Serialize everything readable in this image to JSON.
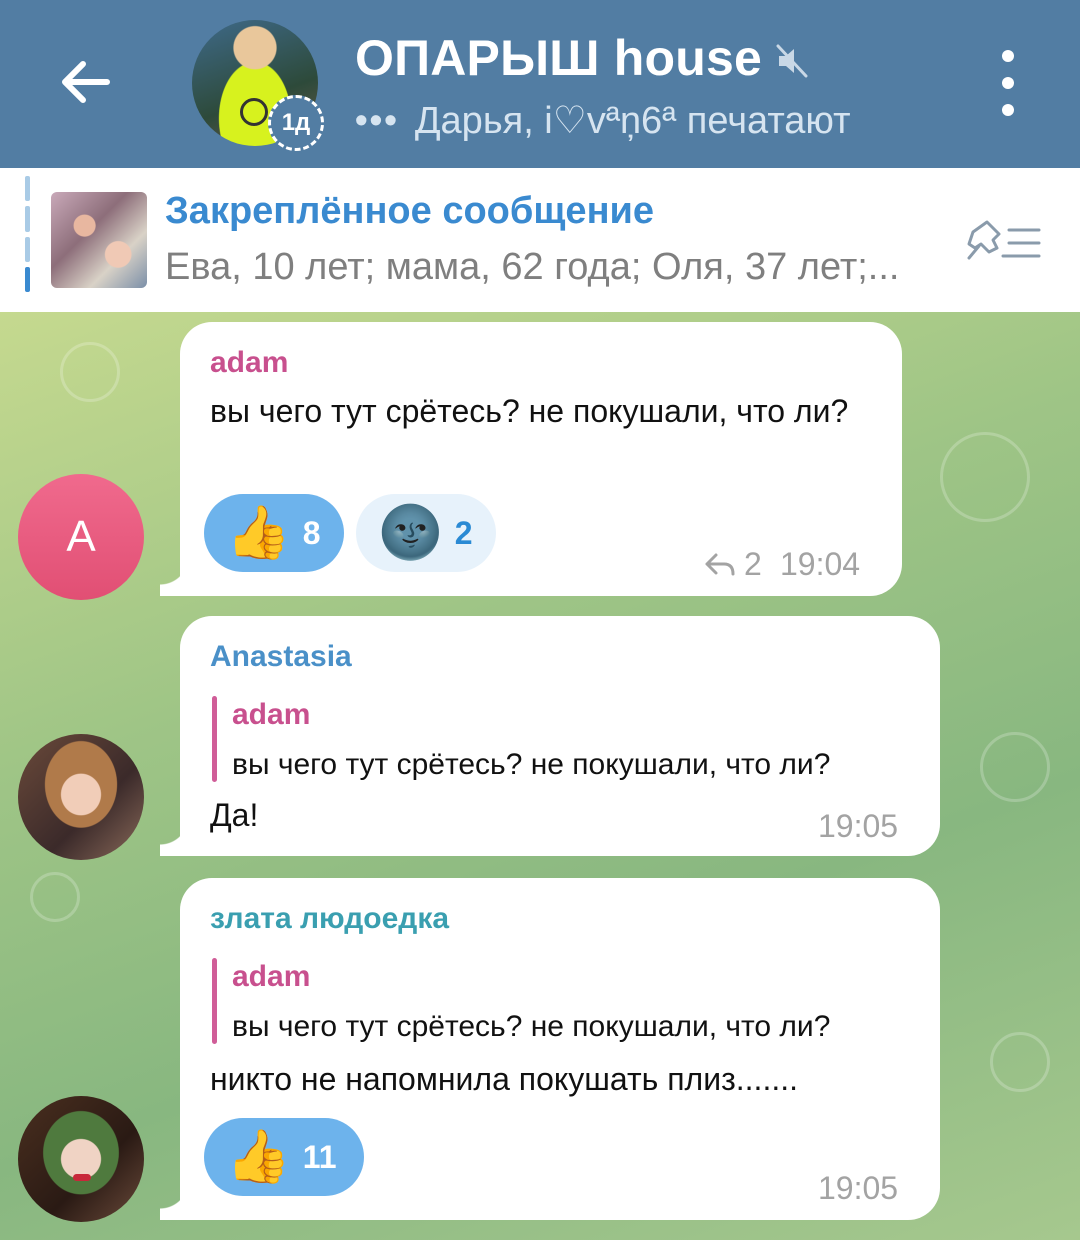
{
  "header": {
    "title": "ОПАРЫШ house",
    "status_prefix": "•••",
    "status": "Дарья, i♡vªņ6ª печатают",
    "story_badge": "1д",
    "icons": [
      "back-arrow-icon",
      "mute-icon",
      "more-vert-icon"
    ],
    "colors": {
      "bar": "#527da3"
    }
  },
  "pinned": {
    "label": "Закреплённое сообщение",
    "text": "Ева, 10 лет; мама, 62 года; Оля, 37 лет;...",
    "icon": "pinned-list-icon"
  },
  "messages": [
    {
      "sender": "adam",
      "sender_color": "#c8508e",
      "avatar_letter": "A",
      "text": "вы чего тут срётесь? не покушали, что ли?",
      "time": "19:04",
      "replies_count": "2",
      "reactions": [
        {
          "emoji": "👍",
          "count": "8",
          "mine": true
        },
        {
          "emoji": "🌚",
          "count": "2",
          "mine": false
        }
      ]
    },
    {
      "sender": "Anastasia",
      "sender_color": "#4a90c8",
      "reply": {
        "sender": "adam",
        "text": "вы чего тут срётесь? не покушали, что ли?"
      },
      "text": "Да!",
      "time": "19:05"
    },
    {
      "sender": "злата людоедка",
      "sender_color": "#3a9fb0",
      "reply": {
        "sender": "adam",
        "text": "вы чего тут срётесь? не покушали, что ли?"
      },
      "text": "никто не напомнила покушать плиз.......",
      "time": "19:05",
      "reactions": [
        {
          "emoji": "👍",
          "count": "11",
          "mine": true
        }
      ]
    }
  ]
}
